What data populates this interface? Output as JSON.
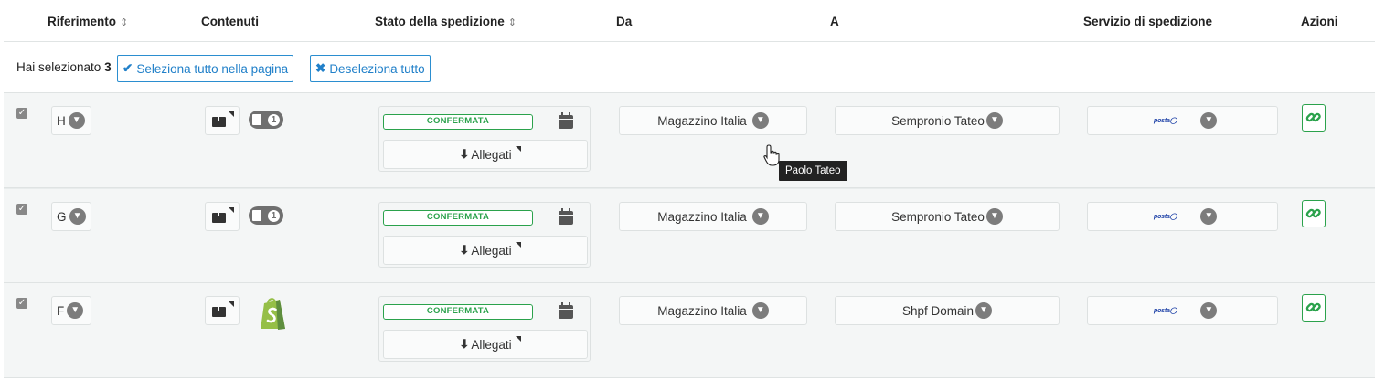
{
  "headers": {
    "riferimento": "Riferimento",
    "contenuti": "Contenuti",
    "stato": "Stato della spedizione",
    "da": "Da",
    "a": "A",
    "servizio": "Servizio di spedizione",
    "azioni": "Azioni"
  },
  "selection": {
    "prefix": "Hai selezionato",
    "count": "3",
    "select_all_label": "Seleziona tutto nella pagina",
    "deselect_all_label": "Deseleziona tutto"
  },
  "rows": [
    {
      "checked": true,
      "ref": "H",
      "doc_count": "1",
      "status": "CONFERMATA",
      "attachments_label": "Allegati",
      "from": "Magazzino Italia",
      "to": "Sempronio Tateo",
      "service_logo_text": "posta"
    },
    {
      "checked": true,
      "ref": "G",
      "doc_count": "1",
      "status": "CONFERMATA",
      "attachments_label": "Allegati",
      "from": "Magazzino Italia",
      "to": "Sempronio Tateo",
      "service_logo_text": "posta"
    },
    {
      "checked": true,
      "ref": "F",
      "source_icon": "shopify-icon",
      "status": "CONFERMATA",
      "attachments_label": "Allegati",
      "from": "Magazzino Italia",
      "to": "Shpf Domain",
      "service_logo_text": "posta"
    }
  ],
  "tooltip": "Paolo Tateo",
  "colors": {
    "accent_blue": "#2180c9",
    "success_green": "#2ba24c",
    "row_bg": "#f4f6f6",
    "badge_grey": "#7c7c7c"
  }
}
